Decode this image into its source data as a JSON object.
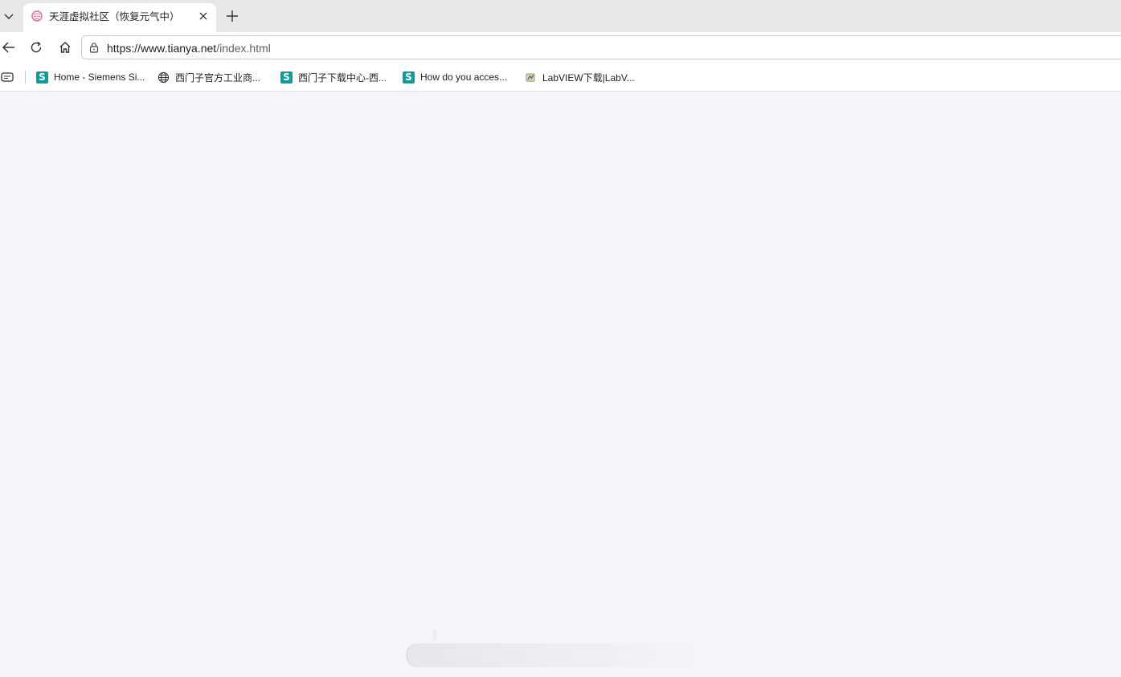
{
  "tab": {
    "title": "天涯虚拟社区（恢复元气中）"
  },
  "address_bar": {
    "url_main": "https://www.tianya.net",
    "url_rest": "/index.html"
  },
  "bookmarks": [
    {
      "label": "Home - Siemens Si...",
      "icon": "siemens-s-icon"
    },
    {
      "label": "西门子官方工业商...",
      "icon": "globe-icon"
    },
    {
      "label": "西门子下载中心-西...",
      "icon": "siemens-s-icon"
    },
    {
      "label": "How do you acces...",
      "icon": "siemens-s-icon"
    },
    {
      "label": "LabVIEW下载|LabV...",
      "icon": "labview-icon"
    }
  ],
  "bookmark_badge_letter": "S",
  "colors": {
    "siemens_teal": "#0f9b9b",
    "tabstrip_bg": "#e7e7e9",
    "page_bg": "#f5f6fa",
    "favicon_pink": "#e86a8a"
  }
}
